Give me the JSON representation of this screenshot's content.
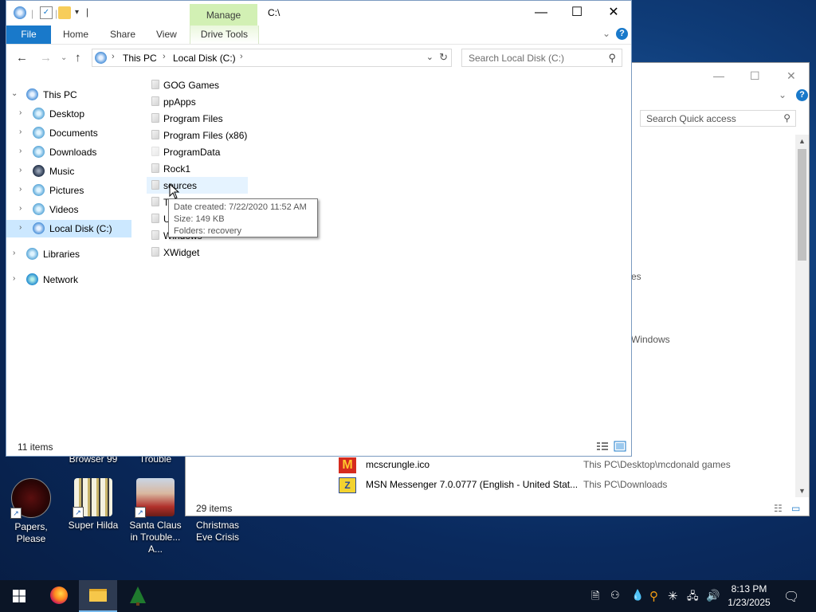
{
  "desktop": {
    "partial_labels": [
      "Browser 99",
      "Trouble"
    ],
    "icons": [
      {
        "label": "Papers, Please"
      },
      {
        "label": "Super Hilda"
      },
      {
        "label": "Santa Claus in Trouble... A..."
      },
      {
        "label": "Christmas Eve Crisis"
      }
    ]
  },
  "bg_window": {
    "search_placeholder": "Search Quick access",
    "partial_texts": [
      "es",
      "Windows"
    ],
    "rows": [
      {
        "name": "mcscrungle.ico",
        "path": "This PC\\Desktop\\mcdonald games"
      },
      {
        "name": "MSN Messenger 7.0.0777 (English - United Stat...",
        "path": "This PC\\Downloads"
      }
    ],
    "status": "29 items"
  },
  "window": {
    "manage_tab": "Manage",
    "title": "C:\\",
    "ribbon_tabs": {
      "file": "File",
      "home": "Home",
      "share": "Share",
      "view": "View",
      "drive_tools": "Drive Tools"
    },
    "address": [
      "This PC",
      "Local Disk (C:)"
    ],
    "search_placeholder": "Search Local Disk (C:)",
    "tree": {
      "this_pc": "This PC",
      "desktop": "Desktop",
      "documents": "Documents",
      "downloads": "Downloads",
      "music": "Music",
      "pictures": "Pictures",
      "videos": "Videos",
      "local_disk": "Local Disk (C:)",
      "libraries": "Libraries",
      "network": "Network"
    },
    "folders": [
      "GOG Games",
      "ppApps",
      "Program Files",
      "Program Files (x86)",
      "ProgramData",
      "Rock1",
      "sources",
      "T",
      "U",
      "Windows",
      "XWidget"
    ],
    "tooltip": {
      "date": "Date created: 7/22/2020 11:52 AM",
      "size": "Size: 149 KB",
      "folders": "Folders: recovery"
    },
    "status": "11 items"
  },
  "taskbar": {
    "time": "8:13 PM",
    "date": "1/23/2025"
  },
  "colors": {
    "accent": "#1979ca",
    "manage_green": "#d2f0b4",
    "selection": "#cce8ff",
    "taskbar": "#0b1526"
  }
}
